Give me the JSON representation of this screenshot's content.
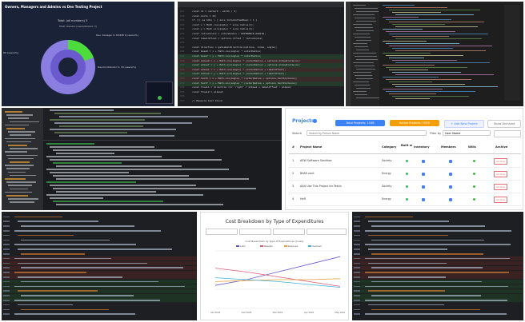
{
  "pie_panel": {
    "title": "Owners, Managers and Admins vs Dev Testing Project",
    "subtitle": "Total: (all numbers) 3",
    "legend_top": "Total: Owners (users/shared: 3)",
    "slice_label_1": "Dev manager In MAE/B  9 (users/%)",
    "slice_label_2": "Dev/Contributor S: 18 (users/%)",
    "left_label": "80 (users/%)",
    "colors": {
      "outer": "#8a7fe0",
      "accent": "#4cdc3c",
      "inner": "#6a5acd",
      "bg": "#202a44"
    }
  },
  "code_top": {
    "lines": [
      {
        "no": "217",
        "text": "const dx = centerX - width / 2;"
      },
      {
        "no": "218",
        "text": "const slots = 24;"
      },
      {
        "no": "219",
        "text": "if (!( as SVG) ) {  axis.totalAuthedRepo = 1 }"
      },
      {
        "no": "220",
        "text": "const x = Math.cos(angle) * size.radius(1);"
      },
      {
        "no": "221",
        "text": "const y = Math.sin(angle) * size.radius(1);"
      },
      {
        "no": "222",
        "text": "const radiusScale = outerRadius / REFERENCE_RADIUS;"
      },
      {
        "no": "223",
        "text": "const labelOffset = options.offset * radiusScale;"
      },
      {
        "no": "224",
        "text": ""
      },
      {
        "no": "225",
        "text": "const direction = getLabelDirection(options, index, angle);"
      },
      {
        "no": "226",
        "text": "const baseX = x + Math.cos(angle) * outerRadius;"
      },
      {
        "no": "227",
        "text": "const baseY = y + Math.sin(angle) * outerRadius;"
      },
      {
        "no": "228",
        "text": "const elbowX = x + Math.cos(angle) * (outerRadius + options.elbowDistance);"
      },
      {
        "no": "229",
        "text": "const elbowY = y + Math.sin(angle) * (outerRadius + options.elbowDistance);"
      },
      {
        "no": "230",
        "text": "const elbow1 = x + Math.cos(angle) * (outerRadius + labelOffset);"
      },
      {
        "no": "231",
        "text": "const elbow2 = y + Math.sin(angle) * (outerRadius + labelOffset);"
      },
      {
        "no": "232",
        "text": "const textX = x + Math.cos(angle) * (outerRadius + options.textDistance);"
      },
      {
        "no": "233",
        "text": "const textY = y + Math.sin(angle) * (outerRadius + options.textDistance);"
      },
      {
        "no": "234",
        "text": "const final1 = direction === 'right' ? elbow1 + labelOffset : elbow1;"
      },
      {
        "no": "235",
        "text": "const final2 = elbow2;"
      },
      {
        "no": "236",
        "text": ""
      },
      {
        "no": "237",
        "text": "// Measure text block"
      }
    ]
  },
  "projects": {
    "title": "Projects",
    "btn_total": "Total Projects: 1108",
    "btn_active": "Active Projects: 1050",
    "btn_add": "+ Add New Project",
    "btn_archived": "Show Archived",
    "search_label": "Search",
    "search_placeholder": "Search by Person Name",
    "filter_label": "Filter by",
    "filter_value": "User Name",
    "columns": [
      "#",
      "Project Name",
      "Category",
      "Built w",
      "Inventory",
      "Members",
      "Wills",
      "Archive"
    ],
    "rows": [
      {
        "n": "1",
        "name": "AEW Software Sandbox",
        "cat": "Society",
        "arch": "Archive"
      },
      {
        "n": "2",
        "name": "BASE-vout",
        "cat": "Energy",
        "arch": "Archive"
      },
      {
        "n": "3",
        "name": "AAA Use This Project for Testin",
        "cat": "Society",
        "arch": "Archive"
      },
      {
        "n": "4",
        "name": "HeFi",
        "cat": "Energy",
        "arch": "Archive"
      }
    ],
    "accent_blue": "#3b82f6",
    "accent_orange": "#f59e0b"
  },
  "chart_panel": {
    "title": "Cost Breakdown by Type of Expenditures",
    "inner_title": "Cost Breakdown by Type of Expenditures (Costs)"
  },
  "chart_data": {
    "type": "line",
    "title": "Cost Breakdown by Type of Expenditures",
    "x": [
      "Jan 2023",
      "Feb 2023",
      "Mar 2023",
      "Apr 2023",
      "May 2023"
    ],
    "series": [
      {
        "name": "Labor",
        "values": [
          120,
          150,
          190,
          230,
          270
        ],
        "color": "#6a5acd"
      },
      {
        "name": "Materials",
        "values": [
          210,
          190,
          165,
          140,
          115
        ],
        "color": "#e05a7a"
      },
      {
        "name": "Equipment",
        "values": [
          140,
          145,
          150,
          150,
          155
        ],
        "color": "#e8a13a"
      },
      {
        "name": "Overhead",
        "values": [
          160,
          150,
          140,
          125,
          110
        ],
        "color": "#3fb0d9"
      }
    ],
    "ylim": [
      0,
      300
    ]
  }
}
